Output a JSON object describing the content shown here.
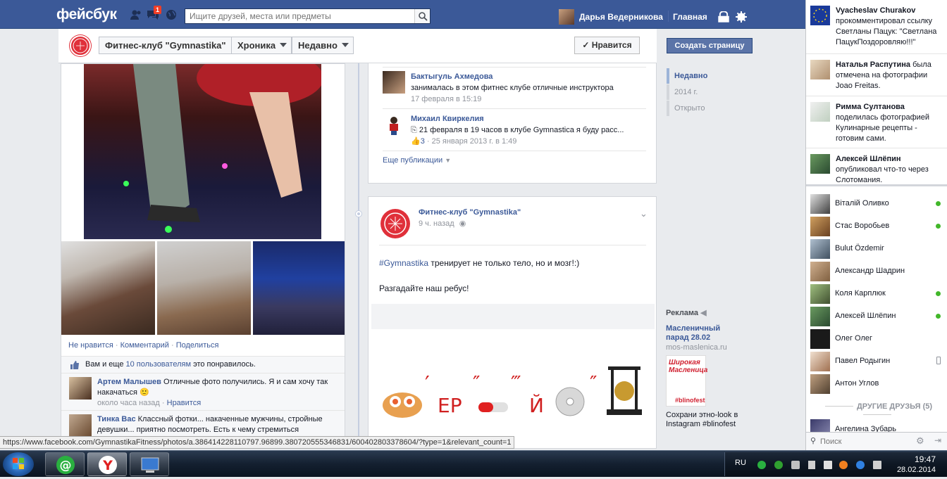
{
  "topbar": {
    "logo": "фейсбук",
    "notification_count": "1",
    "search_placeholder": "Ищите друзей, места или предметы",
    "username": "Дарья Ведерникова",
    "home": "Главная"
  },
  "page_header": {
    "page_name": "Фитнес-клуб \"Gymnastika\"",
    "timeline_label": "Хроника",
    "recent_label": "Недавно",
    "like_button": "✓ Нравится"
  },
  "photo_card": {
    "actions": [
      "Не нравится",
      "Комментарий",
      "Поделиться"
    ],
    "likes_prefix": "Вам и еще ",
    "likes_link": "10 пользователям",
    "likes_suffix": " это понравилось.",
    "comments": [
      {
        "author": "Артем Малышев",
        "text": "Отличные фото получились. Я и сам хочу так накачаться 🙂",
        "time": "около часа назад",
        "like": "Нравится"
      },
      {
        "author": "Тинка Вас",
        "text": "Классный фотки... накаченные мужчины, стройные девушки... приятно посмотреть. Есть к чему стремиться",
        "time": "",
        "like": ""
      }
    ]
  },
  "visitors": [
    {
      "author": "Бактыгуль Ахмедова",
      "text": "занималась в этом фитнес клубе отличные инструктора",
      "meta": "17 февраля в 15:19"
    },
    {
      "author": "Михаил Квиркелия",
      "text": "21 февраля в 19 часов в клубе Gymnastica я буду расс...",
      "likes": "3",
      "meta": "· 25 января 2013 г. в 1:49"
    }
  ],
  "more_posts": "Еще публикации",
  "post": {
    "author": "Фитнес-клуб \"Gymnastika\"",
    "time": "9 ч. назад",
    "hashtag": "#Gymnastika",
    "text1": " тренирует не только тело, но и мозг!:)",
    "text2": "Разгадайте наш ребус!",
    "rebus_er": "ЕР",
    "rebus_y": "Й"
  },
  "sidebar": {
    "create_page": "Создать страницу",
    "years": [
      "Недавно",
      "2014 г.",
      "Открыто"
    ],
    "ad_label": "Реклама",
    "ad_title": "Масленичный парад 28.02",
    "ad_url": "mos-maslenica.ru",
    "ad_desc": "Сохрани этно-look в Instagram #blinofest",
    "ad_img_text": "Широкая Масленица",
    "ad_img_tag": "#blinofest"
  },
  "ticker": [
    {
      "name": "Vyacheslav Churakov",
      "text": " прокомментировал ссылку Светланы Пацук: \"Светлана ПацукПоздоровляю!!!\""
    },
    {
      "name": "Наталья Распутина",
      "text": " была отмечена на фотографии Joao Freitas."
    },
    {
      "name": "Римма Султанова",
      "text": " поделилась фотографией Кулинарные рецепты - готовим сами."
    },
    {
      "name": "Алексей Шлёпин",
      "text": " опубликовал что-то через Слотомания."
    }
  ],
  "chat": [
    {
      "name": "Віталій Оливко",
      "status": "online"
    },
    {
      "name": "Стас Воробьев",
      "status": "online"
    },
    {
      "name": "Bulut Özdemir",
      "status": ""
    },
    {
      "name": "Александр Шадрин",
      "status": ""
    },
    {
      "name": "Коля Карплюк",
      "status": "online"
    },
    {
      "name": "Алексей Шлёпин",
      "status": "online"
    },
    {
      "name": "Олег Олег",
      "status": ""
    },
    {
      "name": "Павел Родыгин",
      "status": "mobile"
    },
    {
      "name": "Антон Углов",
      "status": ""
    }
  ],
  "other_friends": "ДРУГИЕ ДРУЗЬЯ (5)",
  "other_friend": "Ангелина Зубарь",
  "chat_search_placeholder": "Поиск",
  "status_url": "https://www.facebook.com/GymnastikaFitness/photos/a.386414228110797.96899.380720555346831/600402803378604/?type=1&relevant_count=1",
  "taskbar": {
    "lang": "RU",
    "time": "19:47",
    "date": "28.02.2014"
  },
  "colors": {
    "brand": "#3b5998",
    "online": "#42b72a",
    "badge": "#f03d25"
  }
}
